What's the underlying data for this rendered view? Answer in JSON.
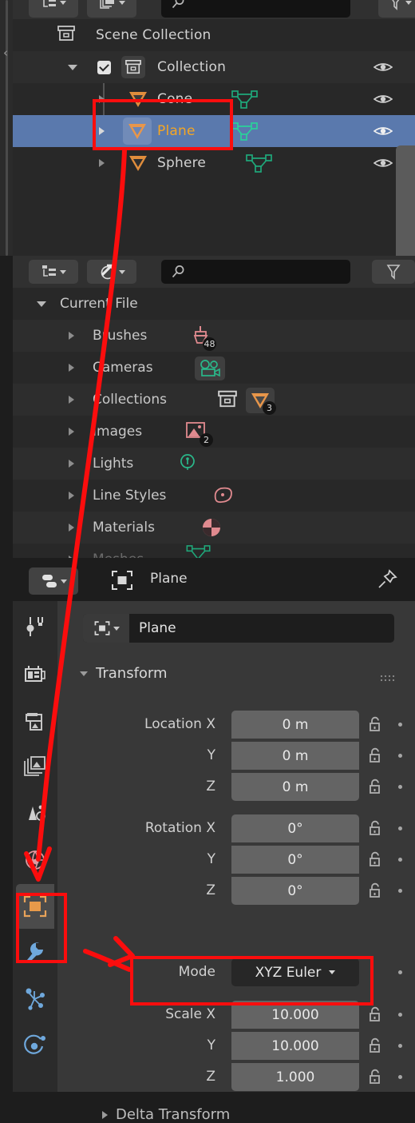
{
  "app": "Blender",
  "outliner_scene": {
    "header": {
      "display_mode_icon": "outliner-display-mode-icon",
      "filter_toggle_icon": "outliner-id-type-icon",
      "search_placeholder": "",
      "search_icon": "search-icon",
      "filter_icon": "filter-funnel-icon"
    },
    "rows": [
      {
        "label": "Scene Collection",
        "icon": "scene-collection-icon",
        "indent": 0,
        "disclosure": "none",
        "checkbox": false,
        "visible_icon": "",
        "selected": false,
        "data_icon": ""
      },
      {
        "label": "Collection",
        "icon": "collection-icon",
        "indent": 1,
        "disclosure": "open",
        "checkbox": true,
        "visible_icon": "eye-icon",
        "selected": false,
        "data_icon": ""
      },
      {
        "label": "Cone",
        "icon": "mesh-object-icon",
        "indent": 2,
        "disclosure": "closed",
        "checkbox": false,
        "visible_icon": "eye-icon",
        "selected": false,
        "data_icon": "mesh-data-icon"
      },
      {
        "label": "Plane",
        "icon": "mesh-object-icon",
        "indent": 2,
        "disclosure": "closed",
        "checkbox": false,
        "visible_icon": "eye-icon",
        "selected": true,
        "data_icon": "mesh-data-icon"
      },
      {
        "label": "Sphere",
        "icon": "mesh-object-icon",
        "indent": 2,
        "disclosure": "closed",
        "checkbox": false,
        "visible_icon": "eye-icon",
        "selected": false,
        "data_icon": "mesh-data-icon"
      }
    ],
    "sidebar_tab": {
      "label": "«",
      "name": "collapse-sidebar-handle"
    }
  },
  "outliner_file": {
    "header": {
      "display_mode_icon": "outliner-display-mode-icon",
      "filter_toggle_icon": "outliner-id-type-icon",
      "search_placeholder": "",
      "search_icon": "search-icon",
      "filter_icon": "filter-funnel-icon"
    },
    "root": {
      "label": "Current File",
      "disclosure": "open"
    },
    "rows": [
      {
        "label": "Brushes",
        "icon": "brush-icon",
        "count": "48"
      },
      {
        "label": "Cameras",
        "icon": "camera-icon",
        "count": ""
      },
      {
        "label": "Collections",
        "icon": "collection-icon",
        "count": "3",
        "extra_icon": "mesh-object-icon"
      },
      {
        "label": "Images",
        "icon": "image-icon",
        "count": "2"
      },
      {
        "label": "Lights",
        "icon": "light-icon",
        "count": ""
      },
      {
        "label": "Line Styles",
        "icon": "linestyle-icon",
        "count": ""
      },
      {
        "label": "Materials",
        "icon": "material-icon",
        "count": ""
      },
      {
        "label": "Meshes",
        "icon": "mesh-data-icon",
        "count": ""
      }
    ]
  },
  "properties": {
    "header": {
      "editor_type_icon": "properties-editor-icon",
      "breadcrumb_icon": "object-properties-icon",
      "breadcrumb": "Plane",
      "pin_icon": "pin-icon"
    },
    "tabs": [
      {
        "name": "tool",
        "icon": "tool-icon",
        "active": false
      },
      {
        "name": "render",
        "icon": "render-camera-icon",
        "active": false
      },
      {
        "name": "output",
        "icon": "output-printer-icon",
        "active": false
      },
      {
        "name": "view-layer",
        "icon": "view-layer-images-icon",
        "active": false
      },
      {
        "name": "scene",
        "icon": "scene-cone-icon",
        "active": false
      },
      {
        "name": "world",
        "icon": "world-globe-icon",
        "active": false
      },
      {
        "name": "object",
        "icon": "object-square-icon",
        "active": true
      },
      {
        "name": "modifiers",
        "icon": "wrench-icon",
        "active": false
      },
      {
        "name": "particles",
        "icon": "particles-icon",
        "active": false
      },
      {
        "name": "physics",
        "icon": "physics-orbit-icon",
        "active": false
      }
    ],
    "object_name_field": {
      "icon": "object-properties-icon",
      "value": "Plane"
    },
    "transform": {
      "section_title": "Transform",
      "collapsed": false,
      "grip_icon": "drag-grip-icon",
      "rows": [
        {
          "label": "Location X",
          "value": "0 m",
          "lock": "unlocked-icon",
          "anim": "animate-dot"
        },
        {
          "label": "Y",
          "value": "0 m",
          "lock": "unlocked-icon",
          "anim": "animate-dot"
        },
        {
          "label": "Z",
          "value": "0 m",
          "lock": "unlocked-icon",
          "anim": "animate-dot"
        },
        {
          "label": "Rotation X",
          "value": "0°",
          "lock": "unlocked-icon",
          "anim": "animate-dot"
        },
        {
          "label": "Y",
          "value": "0°",
          "lock": "unlocked-icon",
          "anim": "animate-dot"
        },
        {
          "label": "Z",
          "value": "0°",
          "lock": "unlocked-icon",
          "anim": "animate-dot"
        }
      ],
      "mode": {
        "label": "Mode",
        "value": "XYZ Euler",
        "anim": "animate-dot"
      },
      "scale": [
        {
          "label": "Scale X",
          "value": "10.000",
          "lock": "unlocked-icon",
          "anim": "animate-dot"
        },
        {
          "label": "Y",
          "value": "10.000",
          "lock": "unlocked-icon",
          "anim": "animate-dot"
        },
        {
          "label": "Z",
          "value": "1.000",
          "lock": "unlocked-icon",
          "anim": "animate-dot"
        }
      ]
    },
    "delta_transform": {
      "label": "Delta Transform",
      "collapsed": true
    }
  },
  "annotations": {
    "color": "#fb0d0d",
    "highlight_boxes": [
      {
        "name": "plane-outliner-highlight"
      },
      {
        "name": "object-tab-highlight"
      },
      {
        "name": "scale-xy-highlight"
      }
    ],
    "arrows": [
      {
        "name": "arrow-outliner-to-object-tab"
      },
      {
        "name": "arrow-to-scale-fields"
      }
    ]
  }
}
